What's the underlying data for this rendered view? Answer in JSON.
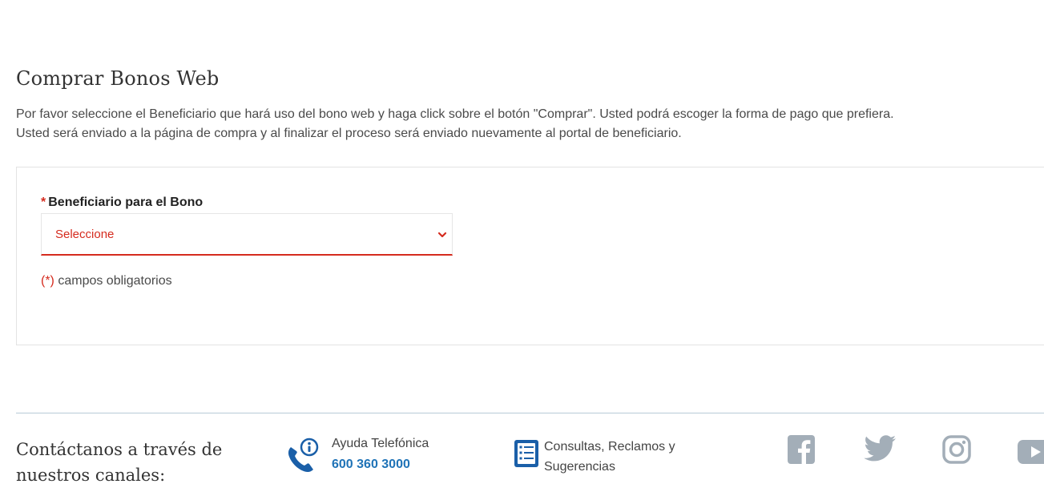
{
  "page": {
    "title": "Comprar Bonos Web",
    "intro_line1": "Por favor seleccione el Beneficiario que hará uso del bono web y haga click sobre el botón \"Comprar\". Usted podrá escoger la forma de pago que prefiera.",
    "intro_line2": "Usted será enviado a la página de compra y al finalizar el proceso será enviado nuevamente al portal de beneficiario."
  },
  "form": {
    "required_star": "*",
    "beneficiary_label": "Beneficiario para el Bono",
    "beneficiary_select_value": "Seleccione",
    "required_note_mark": "(*)",
    "required_note_text": " campos obligatorios"
  },
  "footer": {
    "contact_title": "Contáctanos a través de nuestros canales:",
    "phone_label": "Ayuda Telefónica",
    "phone_number": "600 360 3000",
    "consult_label": "Consultas, Reclamos y Sugerencias",
    "social_icons": [
      "facebook-icon",
      "twitter-icon",
      "instagram-icon",
      "youtube-icon"
    ]
  },
  "colors": {
    "accent_red": "#d52b1e",
    "link_blue": "#1f73b7",
    "icon_blue": "#1a5fa8",
    "social_gray": "#a3aeb8"
  }
}
